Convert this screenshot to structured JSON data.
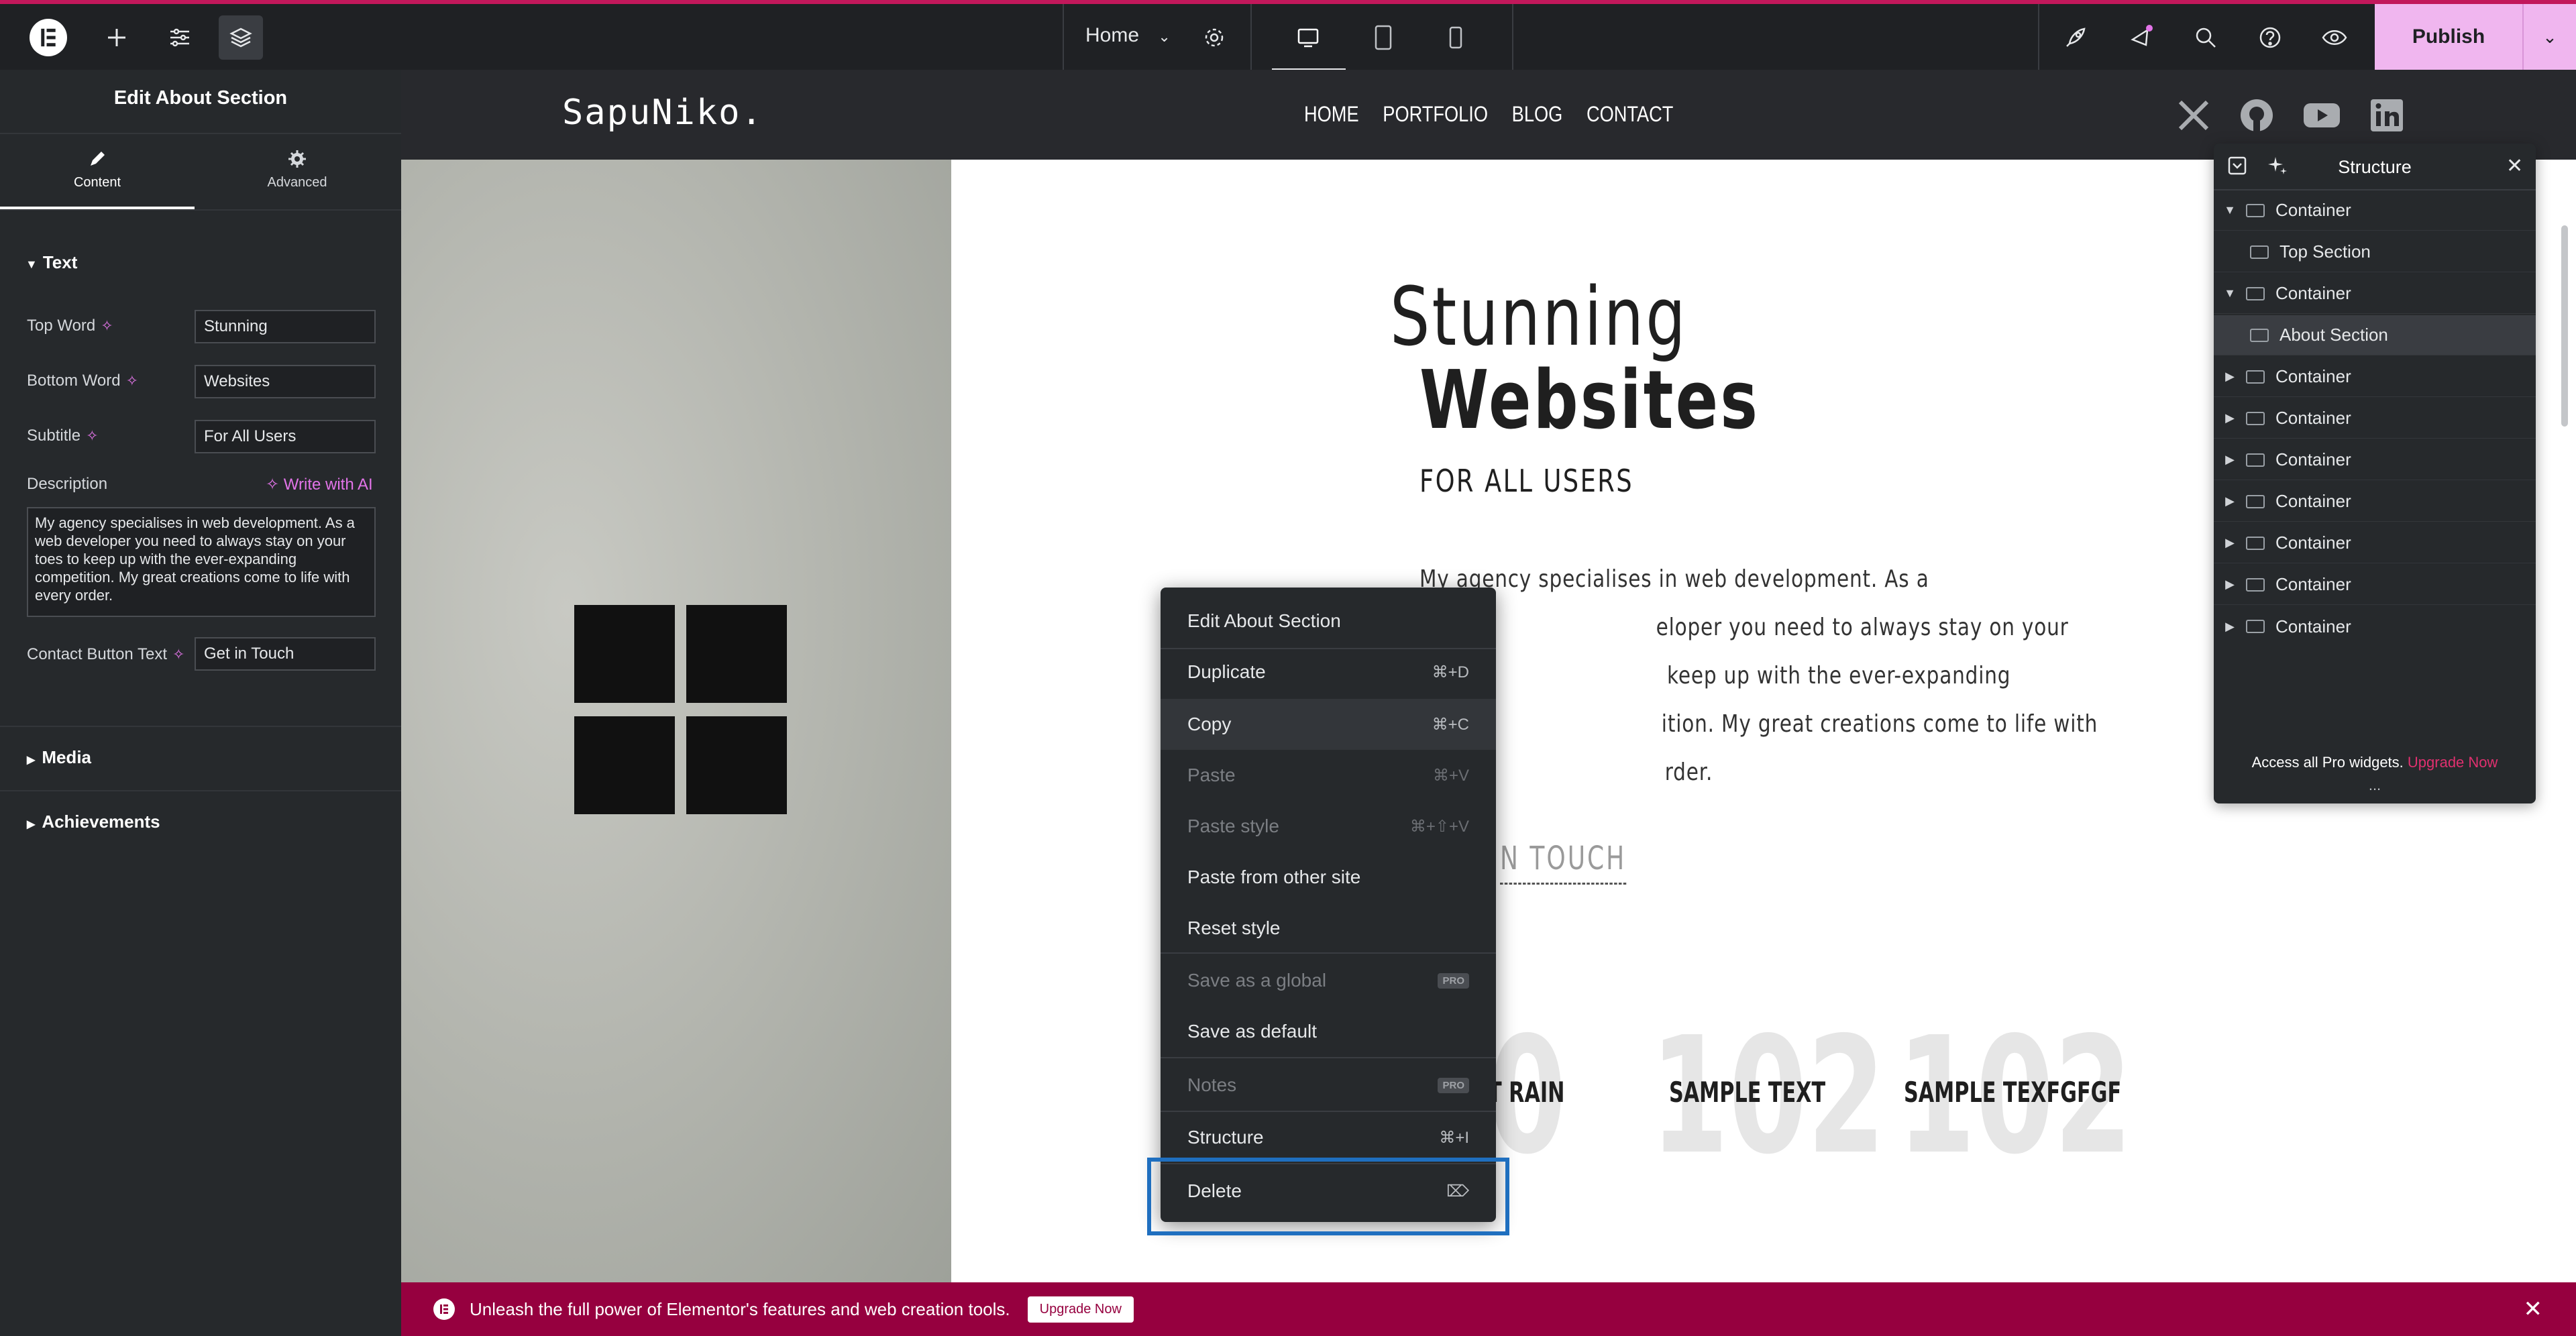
{
  "topbar": {
    "page_selector": "Home",
    "publish_label": "Publish",
    "accent_color": "#c2185b",
    "publish_bg": "#f0b6ef"
  },
  "left_panel": {
    "title": "Edit About Section",
    "tabs": [
      {
        "label": "Content",
        "icon": "pencil-icon",
        "active": true
      },
      {
        "label": "Advanced",
        "icon": "gear-icon",
        "active": false
      }
    ],
    "sections": {
      "text": "Text",
      "media": "Media",
      "achievements": "Achievements"
    },
    "fields": {
      "top_word": {
        "label": "Top Word",
        "value": "Stunning"
      },
      "bottom_word": {
        "label": "Bottom Word",
        "value": "Websites"
      },
      "subtitle": {
        "label": "Subtitle",
        "value": "For All Users"
      },
      "description": {
        "label": "Description",
        "write_ai": "Write with AI",
        "value": "My agency specialises in web development. As a web developer you need to always stay on your toes to keep up with the ever-expanding competition. My great creations come to life with every order."
      },
      "contact_button": {
        "label": "Contact Button Text",
        "value": "Get in Touch"
      }
    }
  },
  "site": {
    "logo": "SapuNiko.",
    "nav": [
      "HOME",
      "PORTFOLIO",
      "BLOG",
      "CONTACT"
    ],
    "social_icons": [
      "x-icon",
      "github-icon",
      "youtube-icon",
      "linkedin-icon"
    ],
    "heading_top": "Stunning",
    "heading_bottom": "Websites",
    "subtitle": "FOR ALL USERS",
    "description_lines": [
      "My agency specialises in web development. As a",
      "eloper you need to always stay on your",
      "keep up with the ever-expanding",
      "ition. My great creations come to life with",
      "rder."
    ],
    "button_partial": "N TOUCH",
    "stats": [
      {
        "number": "0",
        "label": "T RAIN"
      },
      {
        "number": "102",
        "label": "SAMPLE TEXT"
      },
      {
        "number": "102",
        "label": "SAMPLE TEXFGFGF"
      }
    ]
  },
  "context_menu": {
    "items": [
      {
        "label": "Edit About Section",
        "shortcut": "",
        "disabled": false
      },
      {
        "label": "Duplicate",
        "shortcut": "⌘+D",
        "disabled": false
      },
      {
        "label": "Copy",
        "shortcut": "⌘+C",
        "disabled": false
      },
      {
        "label": "Paste",
        "shortcut": "⌘+V",
        "disabled": true
      },
      {
        "label": "Paste style",
        "shortcut": "⌘+⇧+V",
        "disabled": true
      },
      {
        "label": "Paste from other site",
        "shortcut": "",
        "disabled": false
      },
      {
        "label": "Reset style",
        "shortcut": "",
        "disabled": false
      },
      {
        "label": "Save as a global",
        "badge": "PRO",
        "disabled": true
      },
      {
        "label": "Save as default",
        "shortcut": "",
        "disabled": false
      },
      {
        "label": "Notes",
        "badge": "PRO",
        "disabled": true
      },
      {
        "label": "Structure",
        "shortcut": "⌘+I",
        "disabled": false
      },
      {
        "label": "Delete",
        "shortcut": "",
        "disabled": false
      }
    ],
    "highlight_color": "#1f6fbf"
  },
  "structure_panel": {
    "title": "Structure",
    "rows": [
      {
        "label": "Container",
        "level": 0,
        "caret": "down"
      },
      {
        "label": "Top Section",
        "level": 1,
        "caret": ""
      },
      {
        "label": "Container",
        "level": 0,
        "caret": "down"
      },
      {
        "label": "About Section",
        "level": 1,
        "caret": "",
        "selected": true
      },
      {
        "label": "Container",
        "level": 0,
        "caret": "right"
      },
      {
        "label": "Container",
        "level": 0,
        "caret": "right"
      },
      {
        "label": "Container",
        "level": 0,
        "caret": "right"
      },
      {
        "label": "Container",
        "level": 0,
        "caret": "right"
      },
      {
        "label": "Container",
        "level": 0,
        "caret": "right"
      },
      {
        "label": "Container",
        "level": 0,
        "caret": "right"
      },
      {
        "label": "Container",
        "level": 0,
        "caret": "right"
      }
    ],
    "promo_text": "Access all Pro widgets.",
    "promo_link": "Upgrade Now",
    "more": "..."
  },
  "banner": {
    "text": "Unleash the full power of Elementor's features and web creation tools.",
    "button": "Upgrade Now"
  }
}
